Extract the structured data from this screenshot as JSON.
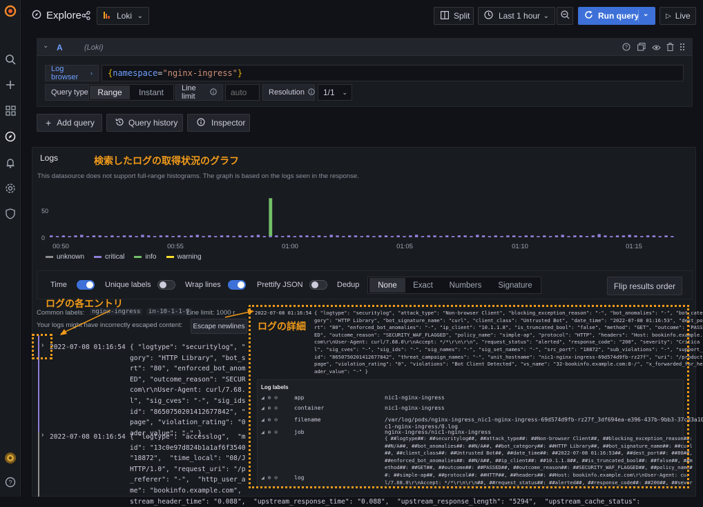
{
  "topbar": {
    "title": "Explore",
    "datasource": "Loki",
    "split_label": "Split",
    "time_range": "Last 1 hour",
    "run_query": "Run query",
    "live": "Live"
  },
  "query": {
    "letter": "A",
    "datasource_tag": "(Loki)",
    "log_browser": "Log browser",
    "expr_prefix": "{",
    "expr_key": "namespace",
    "expr_eq": "=",
    "expr_val": "\"nginx-ingress\"",
    "expr_suffix": "}",
    "query_type_label": "Query type",
    "range": "Range",
    "instant": "Instant",
    "line_limit_label": "Line limit",
    "line_limit_placeholder": "auto",
    "resolution_label": "Resolution",
    "resolution_value": "1/1"
  },
  "actions": {
    "add_query": "Add query",
    "query_history": "Query history",
    "inspector": "Inspector"
  },
  "logs_panel": {
    "title": "Logs",
    "notice": "This datasource does not support full-range histograms. The graph is based on the logs seen in the response.",
    "annotation_graph": "検索したログの取得状況のグラフ",
    "annotation_entry": "ログの各エントリ",
    "annotation_detail": "ログの詳細"
  },
  "chart_data": {
    "type": "bar",
    "y_ticks": [
      "50",
      "0"
    ],
    "ylim": [
      0,
      70
    ],
    "x_ticks": [
      "00:50",
      "00:55",
      "01:00",
      "01:05",
      "01:10",
      "01:15"
    ],
    "legend": [
      {
        "name": "unknown",
        "color": "#8e8e8e"
      },
      {
        "name": "critical",
        "color": "#8f7ed8"
      },
      {
        "name": "info",
        "color": "#73bf69"
      },
      {
        "name": "warning",
        "color": "#fade2a"
      }
    ],
    "series": [
      {
        "name": "critical",
        "color": "#8f7ed8",
        "values": [
          3,
          2,
          3,
          2,
          3,
          4,
          2,
          3,
          3,
          2,
          3,
          2,
          3,
          3,
          2,
          4,
          3,
          2,
          3,
          3,
          2,
          3,
          2,
          3,
          4,
          2,
          3,
          2,
          3,
          3,
          2,
          3,
          2,
          3,
          4,
          2,
          3,
          3,
          2,
          3,
          2,
          3,
          3,
          2,
          3,
          2,
          4,
          3,
          2,
          3,
          3,
          2,
          3,
          2,
          3,
          3,
          2,
          3,
          2,
          3,
          4,
          2,
          3,
          3,
          2,
          3,
          2,
          3,
          3,
          2,
          4,
          3,
          2,
          3,
          2,
          3,
          3,
          2,
          3,
          3,
          2,
          3,
          2,
          3,
          4,
          2,
          3,
          3,
          2,
          3,
          5,
          3,
          2,
          3,
          3,
          4,
          3,
          2,
          3,
          3,
          2,
          3,
          2
        ]
      },
      {
        "name": "info",
        "color": "#73bf69",
        "values": [
          0,
          0,
          0,
          0,
          0,
          0,
          0,
          0,
          0,
          0,
          0,
          0,
          0,
          0,
          0,
          0,
          0,
          0,
          0,
          0,
          0,
          0,
          0,
          0,
          0,
          0,
          0,
          0,
          0,
          0,
          0,
          0,
          0,
          0,
          0,
          0,
          0,
          0,
          0,
          0,
          0,
          0,
          0,
          0,
          0,
          0,
          0,
          0,
          0,
          0,
          0,
          0,
          0,
          0,
          0,
          0,
          0,
          0,
          0,
          0,
          0,
          0,
          0,
          0,
          0,
          0,
          0,
          0,
          0,
          0,
          0,
          0,
          0,
          0,
          0,
          0,
          0,
          0,
          0,
          0,
          0,
          0,
          0,
          0,
          0,
          0,
          0,
          0,
          0,
          0,
          0,
          0,
          0,
          0,
          0,
          0,
          0,
          0,
          0,
          0,
          0,
          0,
          0
        ]
      }
    ],
    "spike_index": 36,
    "spike_value": 62
  },
  "options": {
    "time": "Time",
    "unique_labels": "Unique labels",
    "wrap_lines": "Wrap lines",
    "prettify_json": "Prettify JSON",
    "dedup": "Dedup",
    "dedup_opts": [
      "None",
      "Exact",
      "Numbers",
      "Signature"
    ],
    "flip": "Flip results order"
  },
  "meta": {
    "common_labels_label": "Common labels:",
    "common_labels_value": "nginx-ingress",
    "common_labels_extra": "in-10-1-1-9",
    "line_limit": "Line limit: 1000 r",
    "escape_warning": "Your logs might have incorrectly escaped content:",
    "escape_button": "Escape newlines"
  },
  "log1": {
    "ts": "2022-07-08 01:16:54",
    "lines": [
      "{ \"logtype\": \"securitylog\", \"",
      "gory\": \"HTTP Library\", \"bot_s",
      "rt\": \"80\", \"enforced_bot_anom",
      "ED\", \"outcome_reason\": \"SECUR",
      "com\\r\\nUser-Agent: curl/7.68.",
      "l\", \"sig_cves\": \"-\", \"sig_ids",
      "id\": \"8650750201412677842\", \"",
      "page\", \"violation_rating\": \"0",
      "ader_value\": \"-\" }"
    ]
  },
  "log2": {
    "ts": "2022-07-08 01:16:54",
    "lines": [
      "{ \"logtype\": \"accesslog\",  \"m",
      "id\": \"13c0e97d824b1a1af6f3540",
      "\"18872\",  \"time_local\": \"08/J",
      "HTTP/1.0\", \"request_uri\": \"/p",
      "_referer\": \"-\",  \"http_user_a",
      "me\": \"bookinfo.example.com\",",
      "stream_header_time\": \"0.088\",  \"upstream_response_time\": \"0.088\",  \"upstream_response_length\": \"5294\",  \"upstream_cache_status\":"
    ]
  },
  "detail": {
    "ts": "2022-07-08 01:16:54",
    "lines": [
      "{ \"logtype\": \"securitylog\", \"attack_type\": \"Non-browser Client\", \"blocking_exception_reason\": \"-\", \"bot_anomalies\": \"-\", \"bot_cate",
      "gory\": \"HTTP Library\", \"bot_signature_name\": \"curl\", \"client_class\": \"Untrusted Bot\", \"date_time\": \"2022-07-08 01:16:53\", \"dest_po",
      "rt\": \"80\", \"enforced_bot_anomalies\": \"-\", \"ip_client\": \"10.1.1.8\", \"is_truncated_bool\": \"false\", \"method\": \"GET\", \"outcome\": \"PASS",
      "ED\", \"outcome_reason\": \"SECURITY_WAF_FLAGGED\", \"policy_name\": \"simple-ap\", \"protocol\": \"HTTP\", \"headers\": \"Host: bookinfo.example.",
      "com\\r\\nUser-Agent: curl/7.68.0\\r\\nAccept: */*\\r\\n\\r\\n\", \"request_status\": \"alerted\", \"response_code\": \"200\", \"severity\": \"Critica",
      "l\", \"sig_cves\": \"-\", \"sig_ids\": \"-\", \"sig_names\": \"-\", \"sig_set_names\": \"-\", \"src_port\": \"18872\", \"sub_violations\": \"-\", \"support_",
      "id\": \"8650750201412677842\", \"threat_campaign_names\": \"-\", \"unit_hostname\": \"nic1-nginx-ingress-69d574d9fb-rz27f\", \"uri\": \"/product",
      "page\", \"violation_rating\": \"0\", \"violations\": \"Bot Client Detected\", \"vs_name\": \"32-bookinfo.example.com:8-/\", \"x_forwarded_for_he",
      "ader_value\": \"-\" }"
    ],
    "labels_title": "Log labels",
    "labels": [
      {
        "key": "app",
        "value": "nic1-nginx-ingress"
      },
      {
        "key": "container",
        "value": "nic1-nginx-ingress"
      },
      {
        "key": "filename",
        "value": "/var/log/pods/nginx-ingress_nic1-nginx-ingress-69d574d9fb-rz27f_3df694ea-e396-437b-9bb3-37cd3a1022d0/ni"
      },
      {
        "key": "",
        "value": "c1-nginx-ingress/0.log"
      },
      {
        "key": "job",
        "value": "nginx-ingress/nic1-nginx-ingress"
      }
    ],
    "log_key": "log",
    "log_value_lines": [
      "{ ##logtype##: ##securitylog##, ##attack_type##: ##Non-browser Client##, ##blocking_exception_reason##:",
      "##N/A##, ##bot_anomalies##: ##N/A##, ##bot_category##: ##HTTP Library##, ##bot_signature_name##: ##curl",
      "##, ##client_class##: ##Untrusted Bot##, ##date_time##: ##2022-07-08 01:16:53##, ##dest_port##: ##80##,",
      "##enforced_bot_anomalies##: ##N/A##, ##ip_client##: ##10.1.1.8##, ##is_truncated_bool##: ##false##, ##m",
      "ethod##: ##GET##, ##outcome##: ##PASSED##, ##outcome_reason##: ##SECURITY_WAF_FLAGGED##, ##policy_name#",
      "#: ##simple-ap##, ##protocol##: ##HTTP##, ##headers##: ##Host: bookinfo.example.com\\r\\nUser-Agent: cur",
      "l/7.68.0\\r\\nAccept: */*\\r\\n\\r\\n##, ##request_status##: ##alerted##, ##response_code##: ##200##, ##sever"
    ]
  }
}
